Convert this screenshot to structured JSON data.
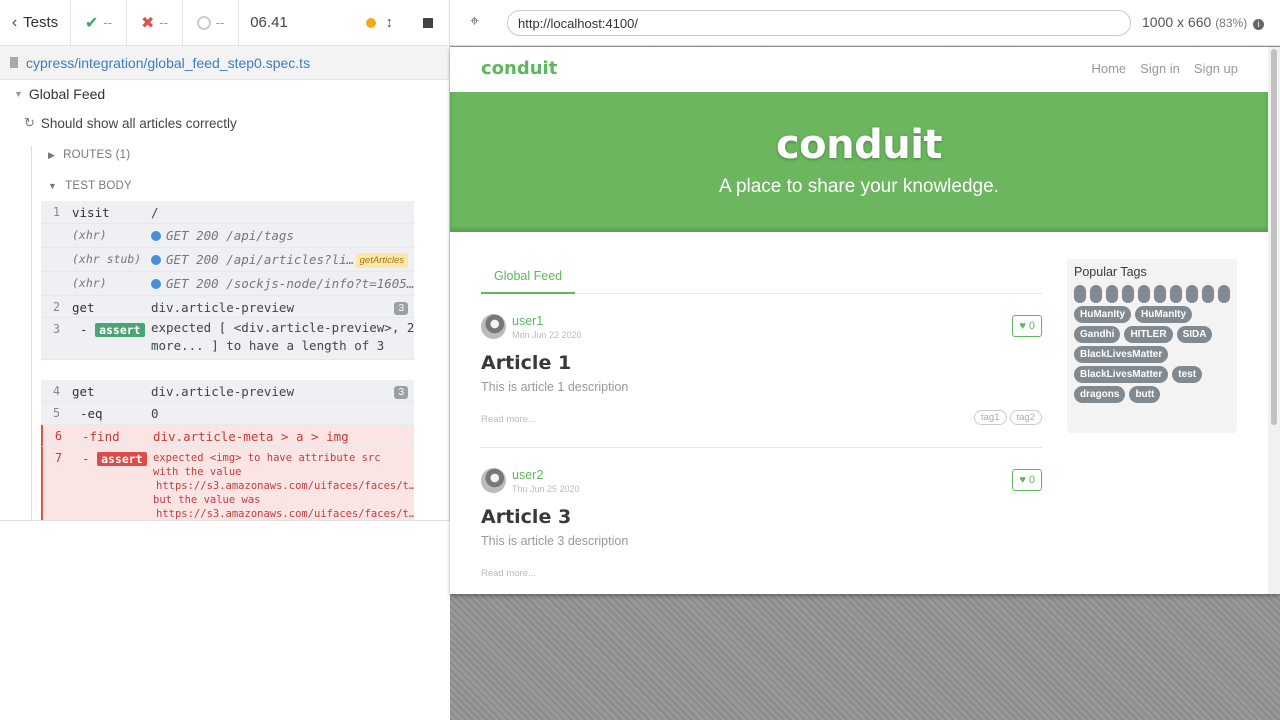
{
  "runner": {
    "back_label": "Tests",
    "passed": "--",
    "failed": "--",
    "pending": "--",
    "duration": "06.41",
    "spec_path": "cypress/integration/global_feed_step0.spec.ts",
    "suite_title": "Global Feed",
    "test_title": "Should show all articles correctly",
    "routes_label": "ROUTES (1)",
    "body_label": "TEST BODY",
    "commands": [
      {
        "num": "1",
        "name": "visit",
        "msg": "/"
      },
      {
        "name": "(xhr)",
        "msg": "GET 200 /api/tags"
      },
      {
        "name": "(xhr stub)",
        "msg": "GET 200 /api/articles?li…",
        "alias": "getArticles"
      },
      {
        "name": "(xhr)",
        "msg": "GET 200 /sockjs-node/info?t=1605…"
      },
      {
        "num": "2",
        "name": "get",
        "msg": "div.article-preview",
        "count": "3"
      },
      {
        "num": "3",
        "name": "-assert",
        "chip": "assert",
        "msg1": "expected [ <div.article-preview>, 2",
        "msg2": "more... ] to have a length of 3"
      },
      {
        "num": "4",
        "name": "get",
        "msg": "div.article-preview",
        "count": "3"
      },
      {
        "num": "5",
        "name": "-eq",
        "msg": "0"
      },
      {
        "num": "6",
        "name": "-find",
        "msg": "div.article-meta > a > img"
      },
      {
        "num": "7",
        "name": "-assert",
        "chip": "assert",
        "lines": [
          "expected <img> to have attribute src",
          "with the value",
          "https://s3.amazonaws.com/uifaces/faces/t…",
          "but the value was",
          "https://s3.amazonaws.com/uifaces/faces/t…"
        ]
      }
    ]
  },
  "browser": {
    "url": "http://localhost:4100/",
    "viewport": "1000 x 660",
    "zoom": "(83%)"
  },
  "app": {
    "brand": "conduit",
    "nav": [
      "Home",
      "Sign in",
      "Sign up"
    ],
    "banner_title": "conduit",
    "banner_subtitle": "A place to share your knowledge.",
    "feed_tab": "Global Feed",
    "articles": [
      {
        "author": "user1",
        "date": "Mon Jun 22 2020",
        "favorites": "0",
        "title": "Article 1",
        "description": "This is article 1 description",
        "read_more": "Read more...",
        "tags": [
          "tag1",
          "tag2"
        ]
      },
      {
        "author": "user2",
        "date": "Thu Jun 25 2020",
        "favorites": "0",
        "title": "Article 3",
        "description": "This is article 3 description",
        "read_more": "Read more...",
        "tags": []
      }
    ],
    "popular_tags_title": "Popular Tags",
    "popular_tags": [
      "HuManIty",
      "HuManIty",
      "Gandhi",
      "HITLER",
      "SIDA",
      "BlackLivesMatter",
      "BlackLivesMatter",
      "test",
      "dragons",
      "butt"
    ],
    "blank_tag_count": 10
  },
  "colors": {
    "accent": "#5cb85c",
    "fail": "#c43d3d",
    "link": "#3c7bc4"
  }
}
